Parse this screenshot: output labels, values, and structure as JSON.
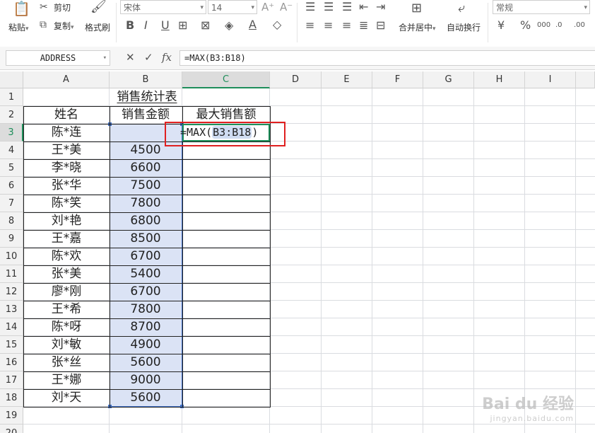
{
  "ribbon": {
    "paste_label": "粘贴",
    "cut_label": "剪切",
    "copy_label": "复制",
    "format_painter_label": "格式刷",
    "font_name": "宋体",
    "font_size": "14",
    "merge_center_label": "合并居中",
    "wrap_text_label": "自动换行",
    "number_format": "常规"
  },
  "formula_bar": {
    "name_box": "ADDRESS",
    "fx_label": "fx",
    "formula": "=MAX(B3:B18)"
  },
  "columns": [
    "A",
    "B",
    "C",
    "D",
    "E",
    "F",
    "G",
    "H",
    "I"
  ],
  "rows": [
    "1",
    "2",
    "3",
    "4",
    "5",
    "6",
    "7",
    "8",
    "9",
    "10",
    "11",
    "12",
    "13",
    "14",
    "15",
    "16",
    "17",
    "18",
    "19",
    "20"
  ],
  "sheet": {
    "title": "销售统计表",
    "header_name": "姓名",
    "header_amount": "销售金额",
    "header_max": "最大销售额",
    "editing_prefix": "=MAX(",
    "editing_ref": "B3:B18",
    "editing_suffix": ")",
    "data": [
      {
        "name": "陈*连",
        "amount": ""
      },
      {
        "name": "王*美",
        "amount": "4500"
      },
      {
        "name": "李*晓",
        "amount": "6600"
      },
      {
        "name": "张*华",
        "amount": "7500"
      },
      {
        "name": "陈*笑",
        "amount": "7800"
      },
      {
        "name": "刘*艳",
        "amount": "6800"
      },
      {
        "name": "王*嘉",
        "amount": "8500"
      },
      {
        "name": "陈*欢",
        "amount": "6700"
      },
      {
        "name": "张*美",
        "amount": "5400"
      },
      {
        "name": "廖*刚",
        "amount": "6700"
      },
      {
        "name": "王*希",
        "amount": "7800"
      },
      {
        "name": "陈*呀",
        "amount": "8700"
      },
      {
        "name": "刘*敏",
        "amount": "4900"
      },
      {
        "name": "张*丝",
        "amount": "5600"
      },
      {
        "name": "王*娜",
        "amount": "9000"
      },
      {
        "name": "刘*天",
        "amount": "5600"
      }
    ]
  },
  "watermark": {
    "brand": "Bai du 经验",
    "url": "jingyan.baidu.com"
  },
  "colors": {
    "active_header": "#1e8e5a",
    "selection_fill": "#dbe3f5",
    "selection_border": "#3f6fc6",
    "annotation_red": "#e02020"
  }
}
